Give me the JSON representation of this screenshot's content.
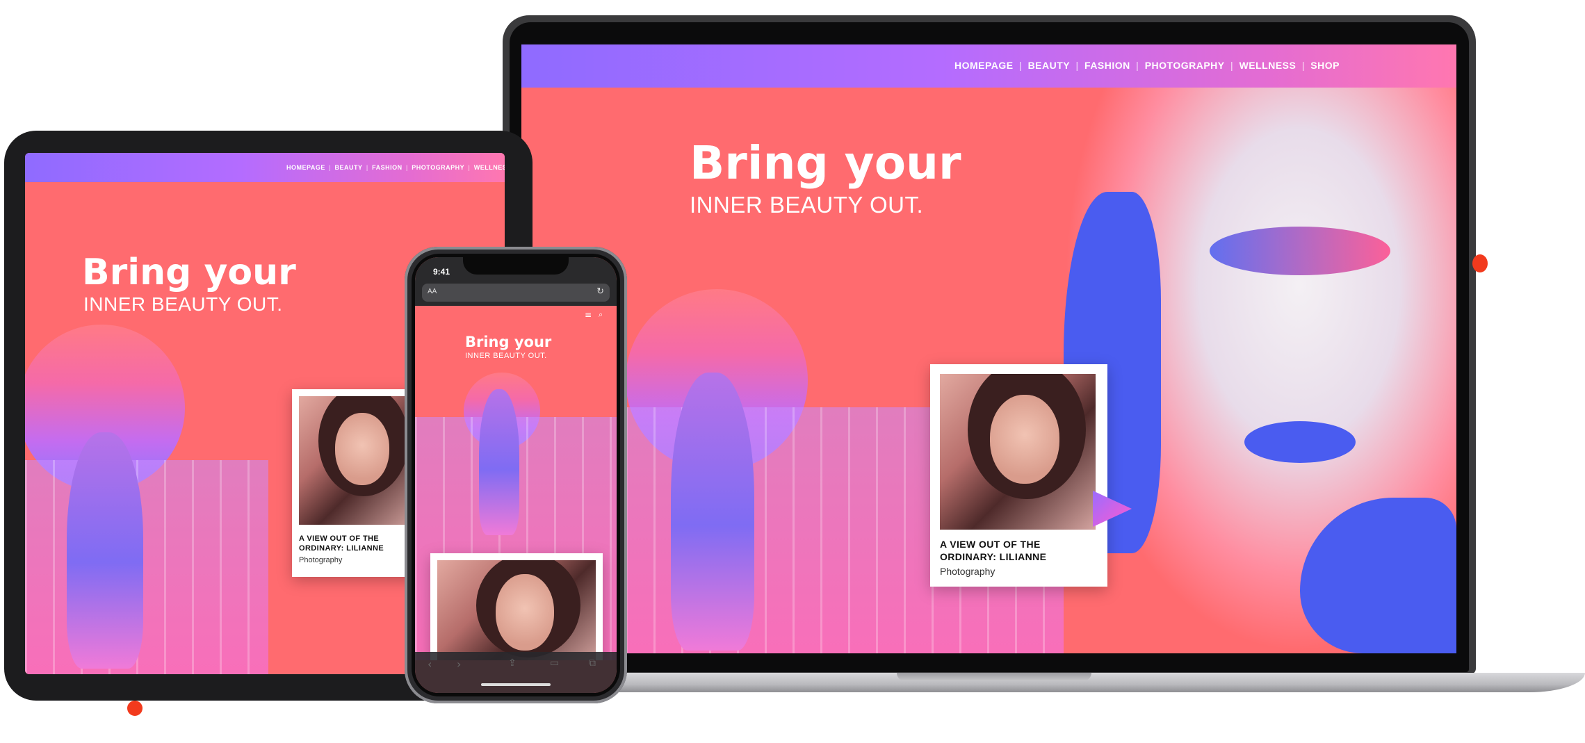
{
  "nav": {
    "items": [
      "HOMEPAGE",
      "BEAUTY",
      "FASHION",
      "PHOTOGRAPHY",
      "WELLNESS",
      "SHOP"
    ],
    "tablet_items": [
      "HOMEPAGE",
      "BEAUTY",
      "FASHION",
      "PHOTOGRAPHY",
      "WELLNESS"
    ],
    "separator": "|"
  },
  "hero": {
    "title": "Bring your",
    "subtitle": "INNER BEAUTY OUT."
  },
  "card": {
    "title_line1": "A VIEW OUT OF THE",
    "title_line2": "ORDINARY: LILIANNE",
    "category": "Photography"
  },
  "phone": {
    "time": "9:41",
    "address_left": "AA",
    "menu_icon": "hamburger-icon",
    "search_icon": "search-icon"
  },
  "colors": {
    "hero_bg": "#ff6b6f",
    "nav_start": "#8f6bff",
    "nav_end": "#ff77b0",
    "accent_dot": "#f23a1d",
    "body_paint": "#4a5cf0"
  }
}
